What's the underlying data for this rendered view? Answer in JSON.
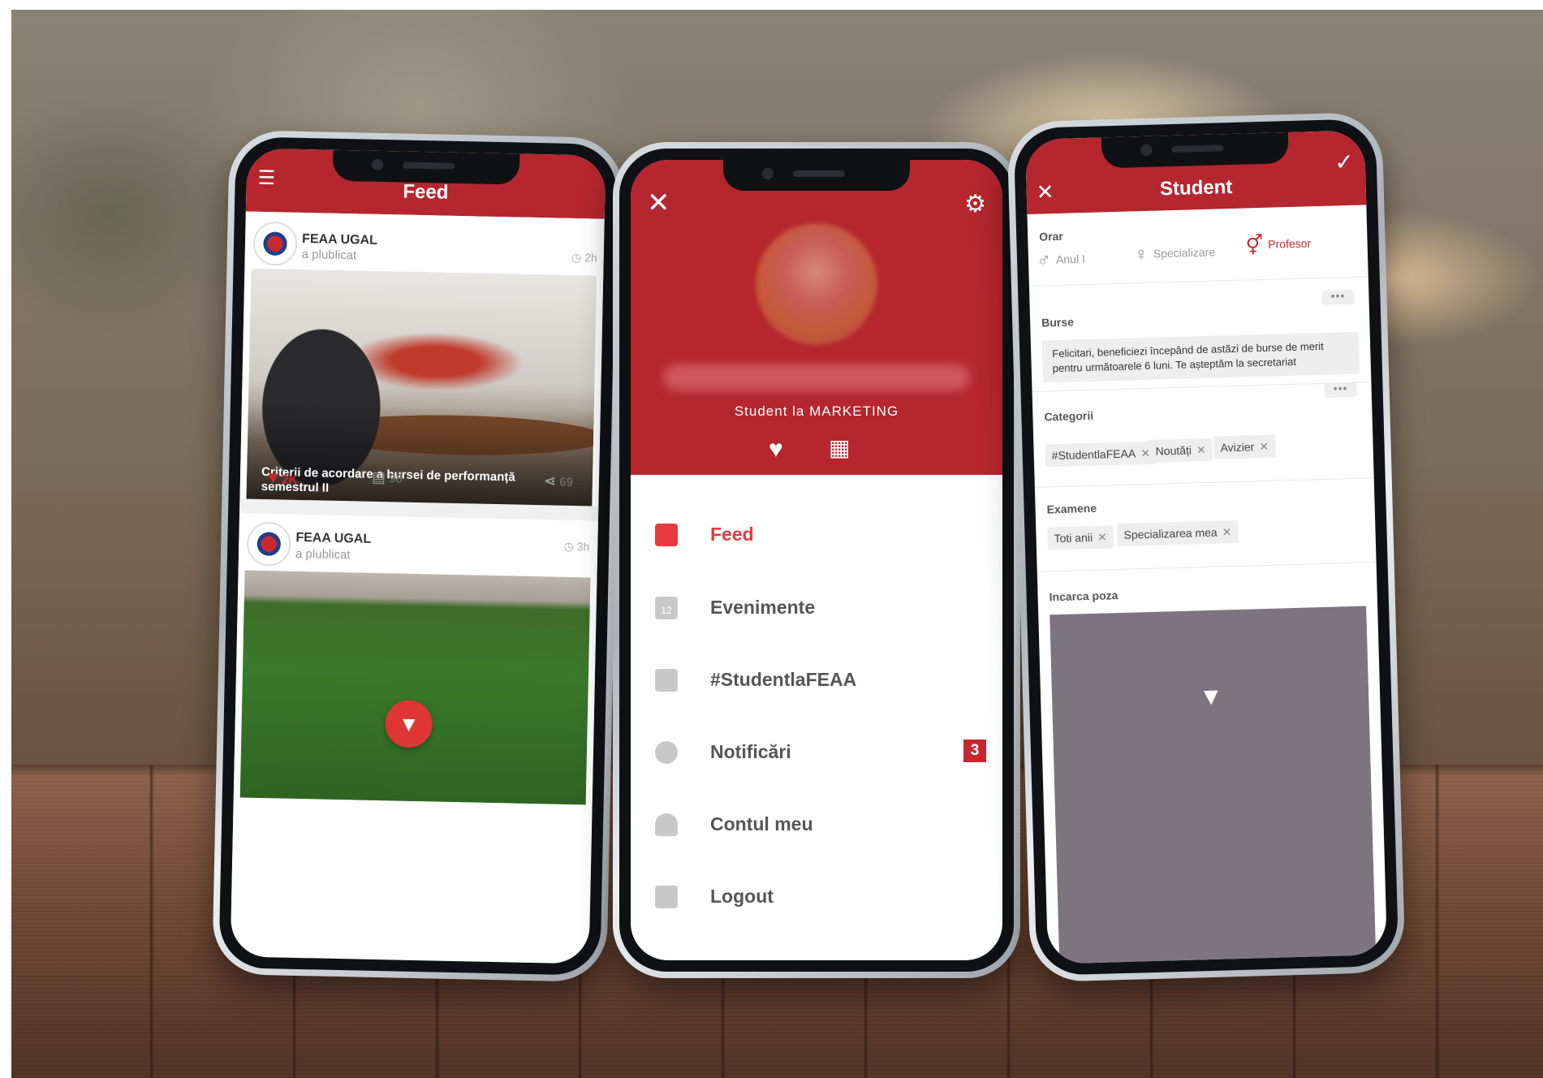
{
  "colors": {
    "brand_red": "#b5262e",
    "accent_red": "#e03535",
    "muted_gray": "#999999"
  },
  "feed_screen": {
    "title": "Feed",
    "menu_icon": "hamburger-icon",
    "posts": [
      {
        "author": "FEAA UGAL",
        "action": "a plublicat",
        "time": "2h",
        "caption": "Criterii de acordare a bursei de performanță semestrul II",
        "likes": "2K",
        "comments": "98",
        "shares": "69"
      },
      {
        "author": "FEAA UGAL",
        "action": "a plublicat",
        "time": "3h"
      }
    ],
    "fab_icon": "filter-icon"
  },
  "menu_screen": {
    "role": "Student la MARKETING",
    "items": [
      {
        "label": "Feed",
        "icon": "feed-icon",
        "active": true
      },
      {
        "label": "Evenimente",
        "icon": "calendar-icon",
        "calendar_day": "12"
      },
      {
        "label": "#StudentlaFEAA",
        "icon": "camera-icon"
      },
      {
        "label": "Notificări",
        "icon": "notification-icon",
        "badge": "3"
      },
      {
        "label": "Contul meu",
        "icon": "user-icon"
      },
      {
        "label": "Logout",
        "icon": "logout-icon"
      }
    ]
  },
  "settings_screen": {
    "title": "Student",
    "orar": {
      "label": "Orar",
      "options": [
        {
          "label": "Anul I",
          "symbol": "♂",
          "selected": false
        },
        {
          "label": "Specializare",
          "symbol": "♀",
          "selected": false
        },
        {
          "label": "Profesor",
          "symbol": "⚥",
          "selected": true
        }
      ]
    },
    "burse": {
      "label": "Burse",
      "text": "Felicitari, beneficiezi începând de astăzi de burse de merit pentru următoarele 6 luni. Te așteptăm la secretariat"
    },
    "categorii": {
      "label": "Categorii",
      "chips": [
        "#StudentlaFEAA",
        "Noutăți",
        "Avizier"
      ]
    },
    "examene": {
      "label": "Examene",
      "chips": [
        "Toti anii",
        "Specializarea mea"
      ]
    },
    "upload": {
      "label": "Incarca poza"
    }
  }
}
